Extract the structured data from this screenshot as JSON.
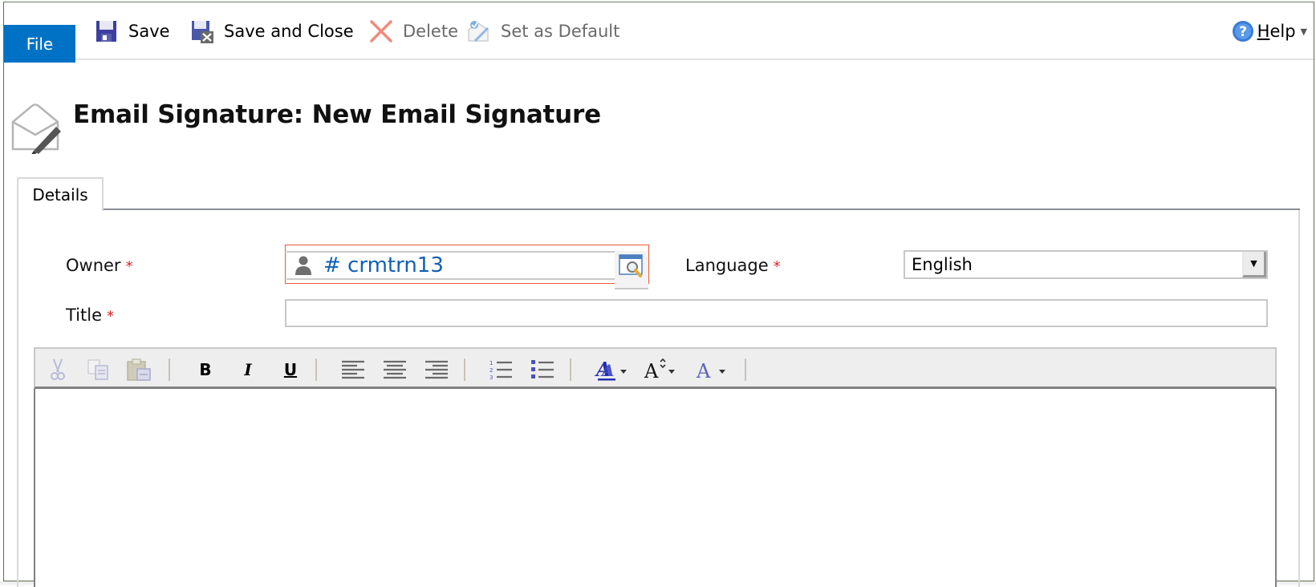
{
  "ribbon": {
    "file_label": "File",
    "save_label": "Save",
    "save_close_label": "Save and Close",
    "delete_label": "Delete",
    "set_default_label": "Set as Default",
    "help_label_first": "H",
    "help_label_rest": "elp"
  },
  "header": {
    "title": "Email Signature: New Email Signature",
    "icon": "email-signature-icon"
  },
  "tabs": [
    {
      "label": "Details",
      "active": true
    }
  ],
  "form": {
    "owner": {
      "label": "Owner",
      "required": "*",
      "value": "# crmtrn13"
    },
    "language": {
      "label": "Language",
      "required": "*",
      "value": "English"
    },
    "title": {
      "label": "Title",
      "required": "*",
      "value": "",
      "placeholder": ""
    }
  },
  "editor": {
    "toolbar": {
      "cut": "cut-icon",
      "copy": "copy-icon",
      "paste": "paste-icon",
      "bold": "B",
      "italic": "I",
      "underline": "U",
      "align_left": "align-left-icon",
      "align_center": "align-center-icon",
      "align_right": "align-right-icon",
      "numbered_list": "numbered-list-icon",
      "bulleted_list": "bulleted-list-icon",
      "font": "A",
      "font_size": "A",
      "font_color": "A"
    },
    "content": ""
  },
  "colors": {
    "accent": "#0072c6",
    "required": "#dd2222",
    "link": "#1160b7",
    "error_border": "#f05a3a"
  }
}
